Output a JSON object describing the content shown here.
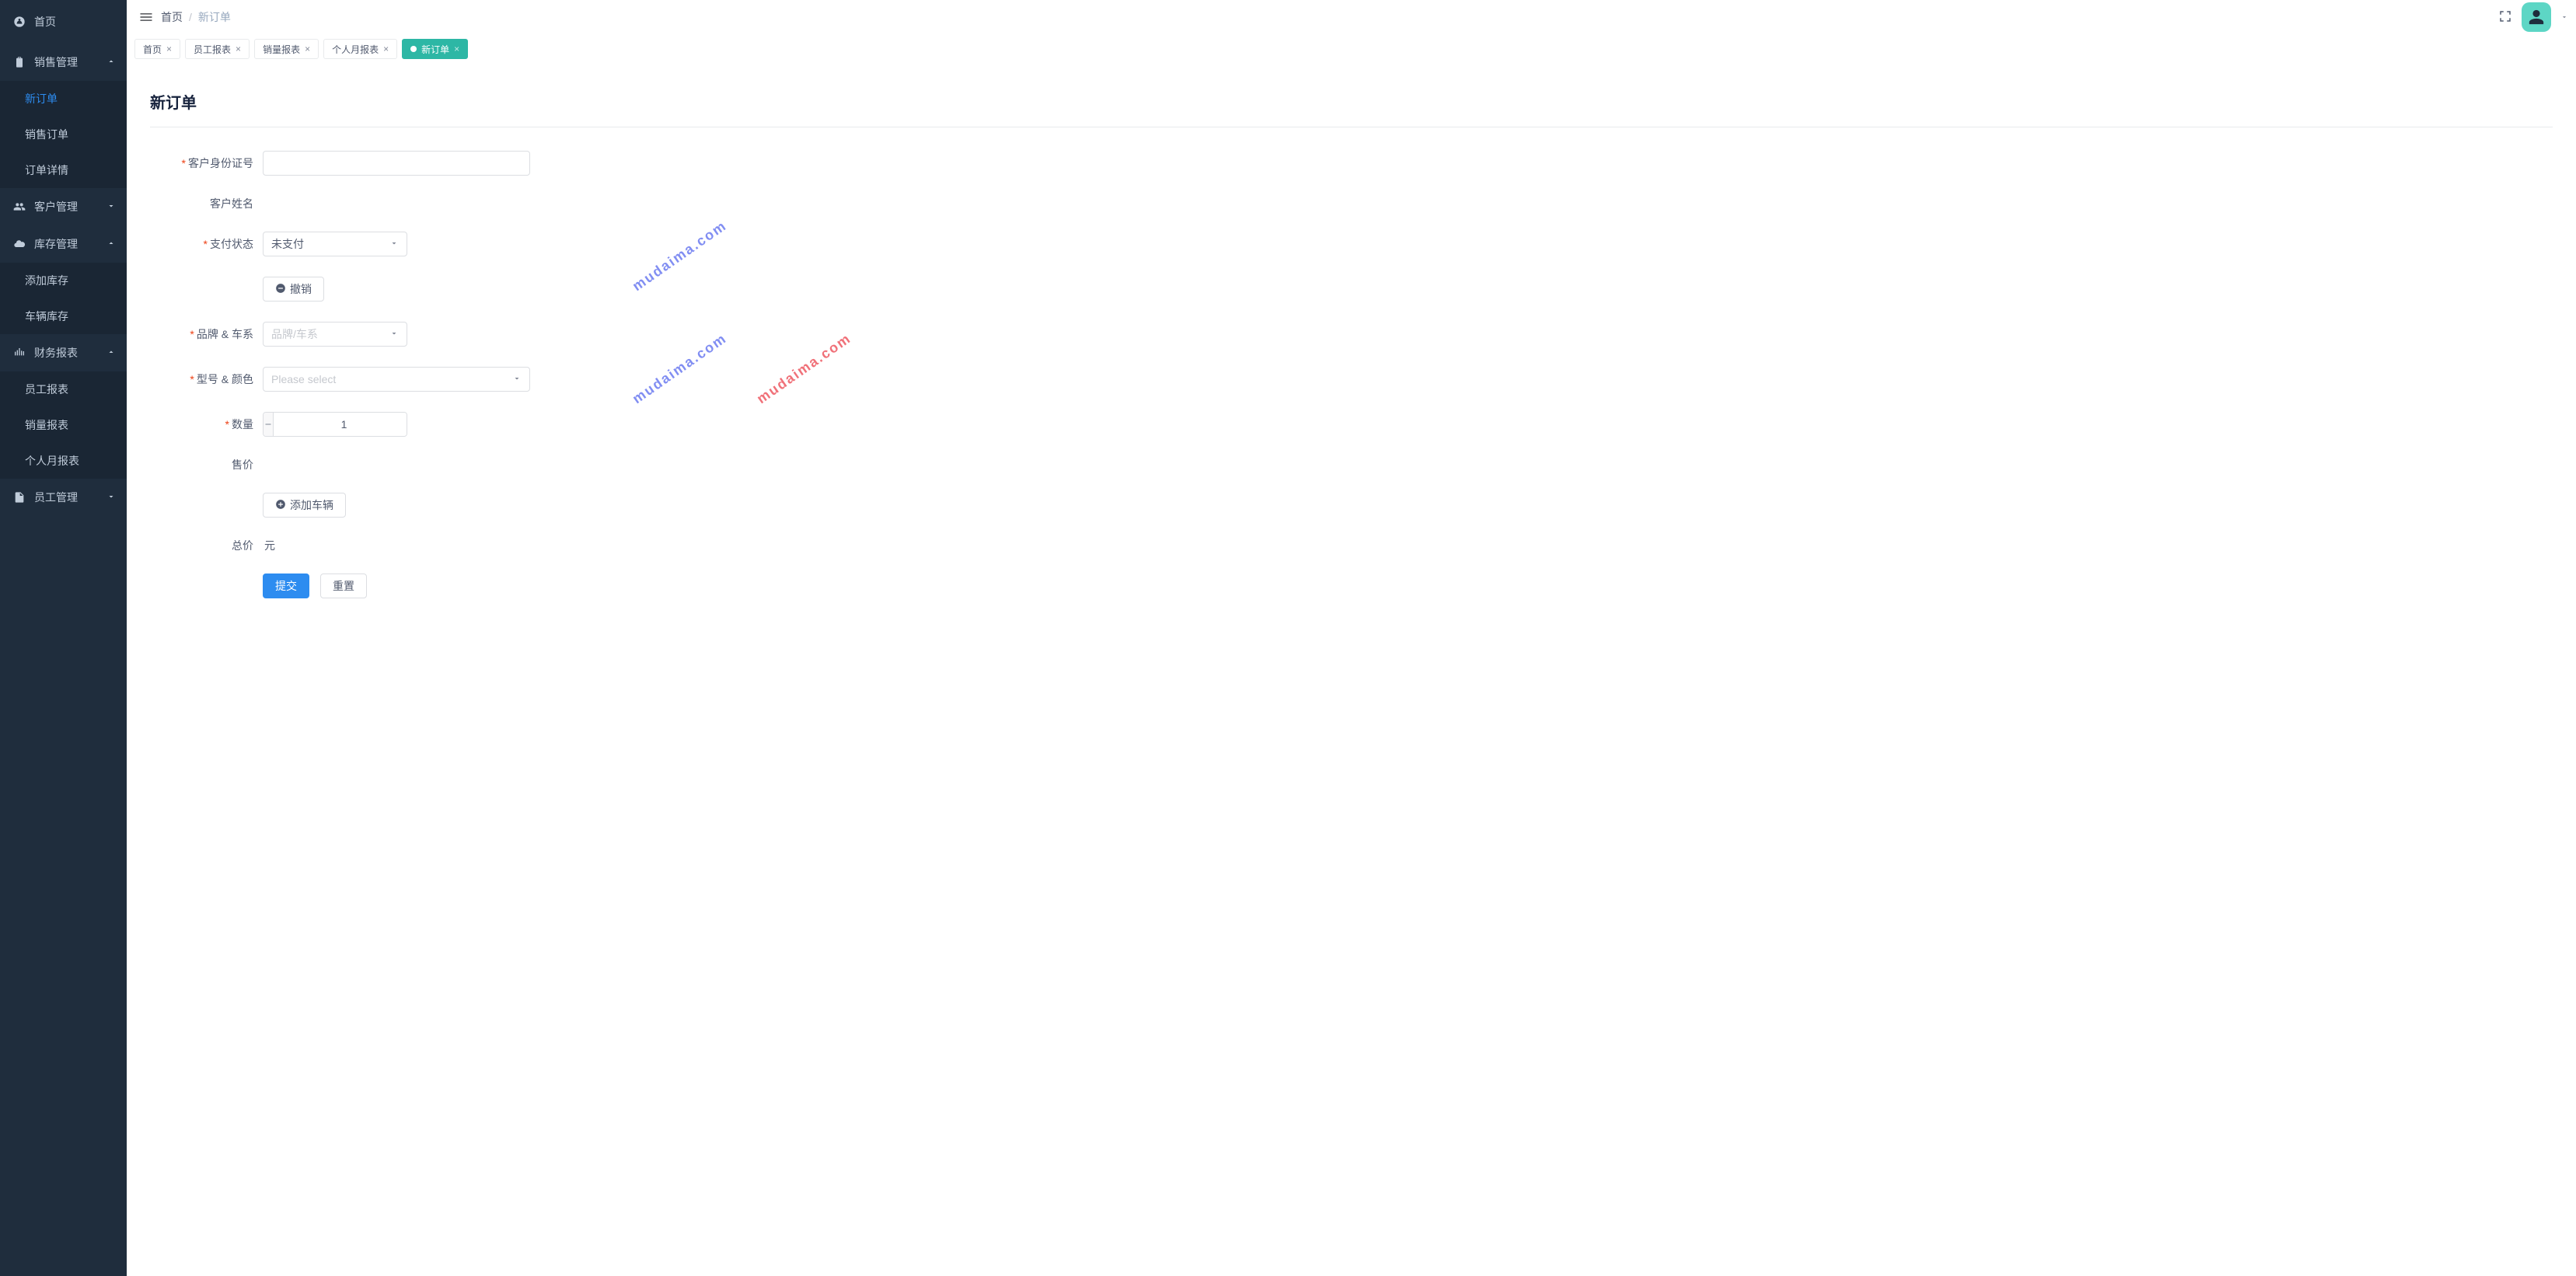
{
  "sidebar": {
    "home": "首页",
    "groups": [
      {
        "label": "销售管理",
        "expanded": true,
        "items": [
          {
            "label": "新订单",
            "active": true
          },
          {
            "label": "销售订单"
          },
          {
            "label": "订单详情"
          }
        ]
      },
      {
        "label": "客户管理",
        "expanded": false,
        "items": []
      },
      {
        "label": "库存管理",
        "expanded": true,
        "items": [
          {
            "label": "添加库存"
          },
          {
            "label": "车辆库存"
          }
        ]
      },
      {
        "label": "财务报表",
        "expanded": true,
        "items": [
          {
            "label": "员工报表"
          },
          {
            "label": "销量报表"
          },
          {
            "label": "个人月报表"
          }
        ]
      },
      {
        "label": "员工管理",
        "expanded": false,
        "items": []
      }
    ]
  },
  "breadcrumb": {
    "home": "首页",
    "current": "新订单"
  },
  "tabs": [
    {
      "label": "首页",
      "closable": true
    },
    {
      "label": "员工报表",
      "closable": true
    },
    {
      "label": "销量报表",
      "closable": true
    },
    {
      "label": "个人月报表",
      "closable": true
    },
    {
      "label": "新订单",
      "closable": true,
      "active": true
    }
  ],
  "page": {
    "title": "新订单"
  },
  "form": {
    "customer_id_label": "客户身份证号",
    "customer_id_value": "",
    "customer_name_label": "客户姓名",
    "customer_name_value": "",
    "pay_status_label": "支付状态",
    "pay_status_value": "未支付",
    "undo_label": "撤销",
    "brand_series_label": "品牌 & 车系",
    "brand_series_placeholder": "品牌/车系",
    "model_color_label": "型号 & 颜色",
    "model_color_placeholder": "Please select",
    "quantity_label": "数量",
    "quantity_value": "1",
    "price_label": "售价",
    "price_value": "",
    "add_vehicle_label": "添加车辆",
    "total_label": "总价",
    "total_value": "元",
    "submit_label": "提交",
    "reset_label": "重置"
  },
  "watermark": "mudaima.com"
}
